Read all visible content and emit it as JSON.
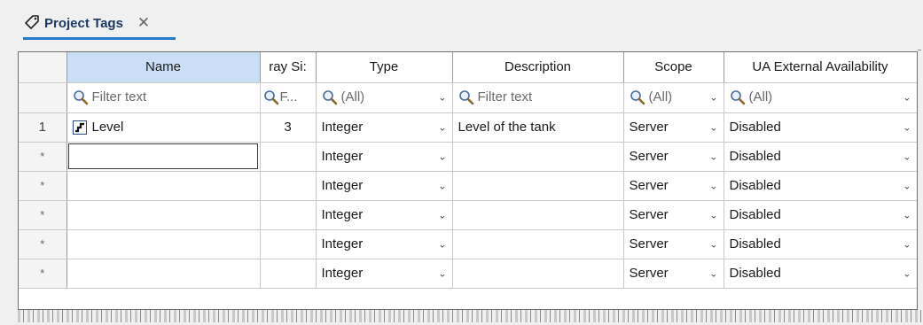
{
  "tab": {
    "title": "Project Tags",
    "close_label": "✕"
  },
  "columns": {
    "name": "Name",
    "array_size": "ray Si:",
    "type": "Type",
    "description": "Description",
    "scope": "Scope",
    "ua": "UA External Availability"
  },
  "filters": {
    "name": "Filter text",
    "array_size": "F...",
    "type": "(All)",
    "description": "Filter text",
    "scope": "(All)",
    "ua": "(All)"
  },
  "rows": [
    {
      "num": "1",
      "name": "Level",
      "array_size": "3",
      "type": "Integer",
      "description": "Level of the tank",
      "scope": "Server",
      "ua": "Disabled"
    },
    {
      "num": "*",
      "name": "",
      "array_size": "",
      "type": "Integer",
      "description": "",
      "scope": "Server",
      "ua": "Disabled"
    },
    {
      "num": "*",
      "name": "",
      "array_size": "",
      "type": "Integer",
      "description": "",
      "scope": "Server",
      "ua": "Disabled"
    },
    {
      "num": "*",
      "name": "",
      "array_size": "",
      "type": "Integer",
      "description": "",
      "scope": "Server",
      "ua": "Disabled"
    },
    {
      "num": "*",
      "name": "",
      "array_size": "",
      "type": "Integer",
      "description": "",
      "scope": "Server",
      "ua": "Disabled"
    },
    {
      "num": "*",
      "name": "",
      "array_size": "",
      "type": "Integer",
      "description": "",
      "scope": "Server",
      "ua": "Disabled"
    }
  ],
  "icons": {
    "tab": "tag-icon",
    "filter": "magnifier-icon",
    "tag_type": "level-tag-icon",
    "dropdown": "chevron-down-icon"
  },
  "colors": {
    "tab_underline": "#2a78c9",
    "header_selected": "#c8dff5"
  }
}
